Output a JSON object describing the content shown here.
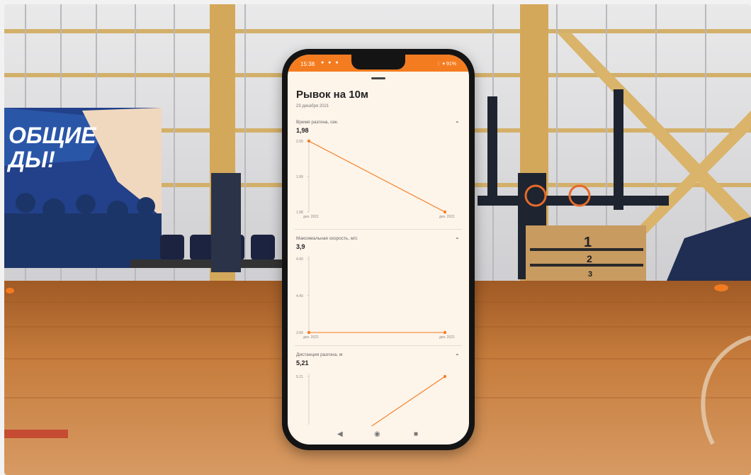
{
  "background": {
    "banner_line1": "ОБЩИЕ",
    "banner_line2": "ДЫ!",
    "podium_places": [
      "1",
      "2",
      "3"
    ]
  },
  "phone": {
    "status_time": "15:38",
    "status_right": "⋮ ▾ 91%",
    "page_title": "Рывок на 10м",
    "page_date": "23 декабря 2021",
    "metrics": [
      {
        "label": "Время разгона, сек.",
        "value": "1,98",
        "y_ticks": [
          "2.00",
          "1.99",
          "1.98"
        ],
        "x_ticks": [
          "дек. 2021",
          "дек. 2021"
        ],
        "points": [
          2.0,
          1.98
        ]
      },
      {
        "label": "Максимальная скорость, м/с",
        "value": "3,9",
        "y_ticks": [
          "4.90",
          "4.40",
          "3.90"
        ],
        "x_ticks": [
          "дек. 2021",
          "дек. 2021"
        ],
        "points": [
          3.9,
          3.9
        ]
      },
      {
        "label": "Дистанция разгона, м",
        "value": "5,21",
        "y_ticks": [
          "5.21",
          "5.17"
        ],
        "x_ticks": [],
        "points": [
          5.16,
          5.21
        ]
      }
    ],
    "nav": {
      "back": "◀",
      "home": "◉",
      "recent": "■"
    }
  },
  "colors": {
    "accent": "#f47c20",
    "screen_bg": "#fdf4ea"
  }
}
